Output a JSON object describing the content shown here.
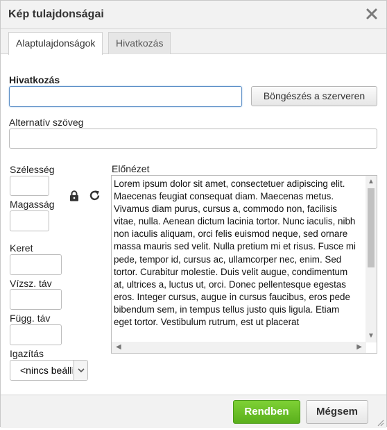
{
  "dialog": {
    "title": "Kép tulajdonságai",
    "close_icon": "close-icon"
  },
  "tabs": [
    {
      "label": "Alaptulajdonságok",
      "active": true
    },
    {
      "label": "Hivatkozás",
      "active": false
    }
  ],
  "link": {
    "label": "Hivatkozás",
    "value": "",
    "browse_label": "Böngészés a szerveren"
  },
  "alt": {
    "label": "Alternatív szöveg",
    "value": ""
  },
  "width": {
    "label": "Szélesség",
    "value": ""
  },
  "height": {
    "label": "Magasság",
    "value": ""
  },
  "lock_icon": "lock-icon",
  "reset_icon": "reset-size-icon",
  "border": {
    "label": "Keret",
    "value": ""
  },
  "hspace": {
    "label": "Vízsz. táv",
    "value": ""
  },
  "vspace": {
    "label": "Függ. táv",
    "value": ""
  },
  "align": {
    "label": "Igazítás",
    "selected": "<nincs beállítva>"
  },
  "preview": {
    "label": "Előnézet",
    "text": "Lorem ipsum dolor sit amet, consectetuer adipiscing elit. Maecenas feugiat consequat diam. Maecenas metus. Vivamus diam purus, cursus a, commodo non, facilisis vitae, nulla. Aenean dictum lacinia tortor. Nunc iaculis, nibh non iaculis aliquam, orci felis euismod neque, sed ornare massa mauris sed velit. Nulla pretium mi et risus. Fusce mi pede, tempor id, cursus ac, ullamcorper nec, enim. Sed tortor. Curabitur molestie. Duis velit augue, condimentum at, ultrices a, luctus ut, orci. Donec pellentesque egestas eros. Integer cursus, augue in cursus faucibus, eros pede bibendum sem, in tempus tellus justo quis ligula. Etiam eget tortor. Vestibulum rutrum, est ut placerat"
  },
  "footer": {
    "ok_label": "Rendben",
    "cancel_label": "Mégsem"
  },
  "colors": {
    "ok_button": "#6cc12a",
    "header_bg": "#f2f2f2",
    "focus_border": "#5c8fc7"
  }
}
